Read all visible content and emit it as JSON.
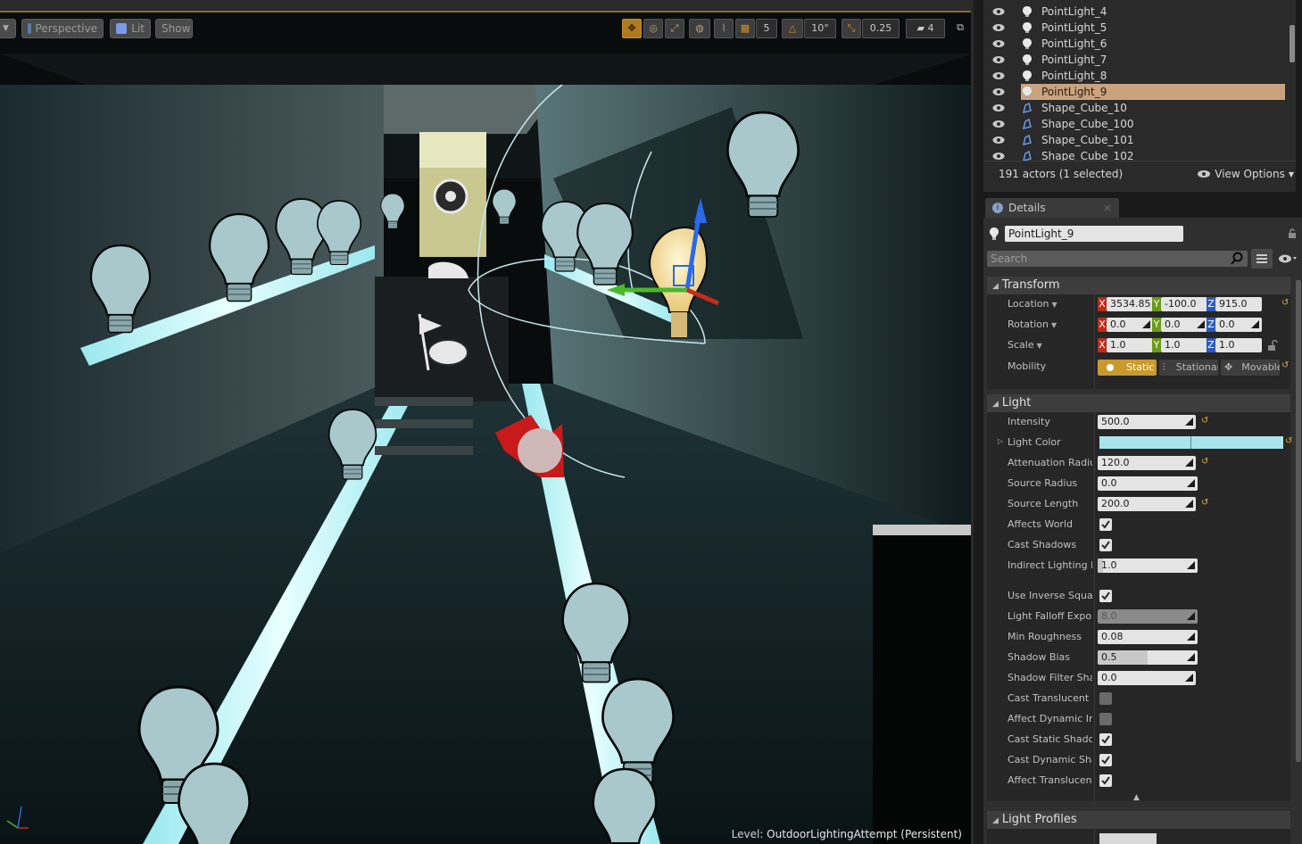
{
  "viewport": {
    "toolbar": {
      "perspective_label": "Perspective",
      "lit_label": "Lit",
      "show_label": "Show",
      "grid_snap": "5",
      "rotation_snap": "10°",
      "scale_snap": "0.25",
      "camera_speed": "4"
    },
    "level_prefix": "Level:",
    "level_name": "OutdoorLightingAttempt (Persistent)"
  },
  "outliner": {
    "items": [
      {
        "label": "PointLight_4",
        "type": "light-icon",
        "selected": false
      },
      {
        "label": "PointLight_5",
        "type": "light-icon",
        "selected": false
      },
      {
        "label": "PointLight_6",
        "type": "light-icon",
        "selected": false
      },
      {
        "label": "PointLight_7",
        "type": "light-icon",
        "selected": false
      },
      {
        "label": "PointLight_8",
        "type": "light-icon",
        "selected": false
      },
      {
        "label": "PointLight_9",
        "type": "light-icon",
        "selected": true
      },
      {
        "label": "Shape_Cube_10",
        "type": "static-mesh-icon",
        "selected": false
      },
      {
        "label": "Shape_Cube_100",
        "type": "static-mesh-icon",
        "selected": false
      },
      {
        "label": "Shape_Cube_101",
        "type": "static-mesh-icon",
        "selected": false
      },
      {
        "label": "Shape_Cube_102",
        "type": "static-mesh-icon",
        "selected": false
      }
    ],
    "actor_count": "191 actors (1 selected)",
    "view_options": "View Options"
  },
  "details": {
    "tab_label": "Details",
    "tab_close": "×",
    "actor_name": "PointLight_9",
    "search_placeholder": "Search",
    "transform": {
      "header": "Transform",
      "location_label": "Location",
      "location": {
        "x": "3534.85",
        "y": "-100.0",
        "z": "915.0"
      },
      "rotation_label": "Rotation",
      "rotation": {
        "x": "0.0",
        "y": "0.0",
        "z": "0.0"
      },
      "scale_label": "Scale",
      "scale": {
        "x": "1.0",
        "y": "1.0",
        "z": "1.0"
      },
      "mobility_label": "Mobility",
      "mobility_options": [
        "Static",
        "Stationary",
        "Movable"
      ],
      "mobility_selected": "Static"
    },
    "light": {
      "header": "Light",
      "intensity_label": "Intensity",
      "intensity": "500.0",
      "light_color_label": "Light Color",
      "light_color": "#a8e4ee",
      "attenuation_radius_label": "Attenuation Radius",
      "attenuation_radius": "120.0",
      "source_radius_label": "Source Radius",
      "source_radius": "0.0",
      "source_length_label": "Source Length",
      "source_length": "200.0",
      "affects_world_label": "Affects World",
      "affects_world": true,
      "cast_shadows_label": "Cast Shadows",
      "cast_shadows": true,
      "indirect_lighting_label": "Indirect Lighting Intensity",
      "indirect_lighting": "1.0",
      "use_inverse_squared_label": "Use Inverse Squared Falloff",
      "use_inverse_squared": true,
      "light_falloff_label": "Light Falloff Exponent",
      "light_falloff": "8.0",
      "min_roughness_label": "Min Roughness",
      "min_roughness": "0.08",
      "shadow_bias_label": "Shadow Bias",
      "shadow_bias": "0.5",
      "shadow_filter_label": "Shadow Filter Sharpen",
      "shadow_filter": "0.0",
      "cast_translucent_label": "Cast Translucent Shadows",
      "cast_translucent": false,
      "affect_dynamic_label": "Affect Dynamic Indirect Lighting",
      "affect_dynamic": false,
      "cast_static_label": "Cast Static Shadows",
      "cast_static": true,
      "cast_dynamic_label": "Cast Dynamic Shadows",
      "cast_dynamic": true,
      "affect_translucent_label": "Affect Translucent Lighting",
      "affect_translucent": true
    },
    "light_profiles": {
      "header": "Light Profiles"
    }
  }
}
